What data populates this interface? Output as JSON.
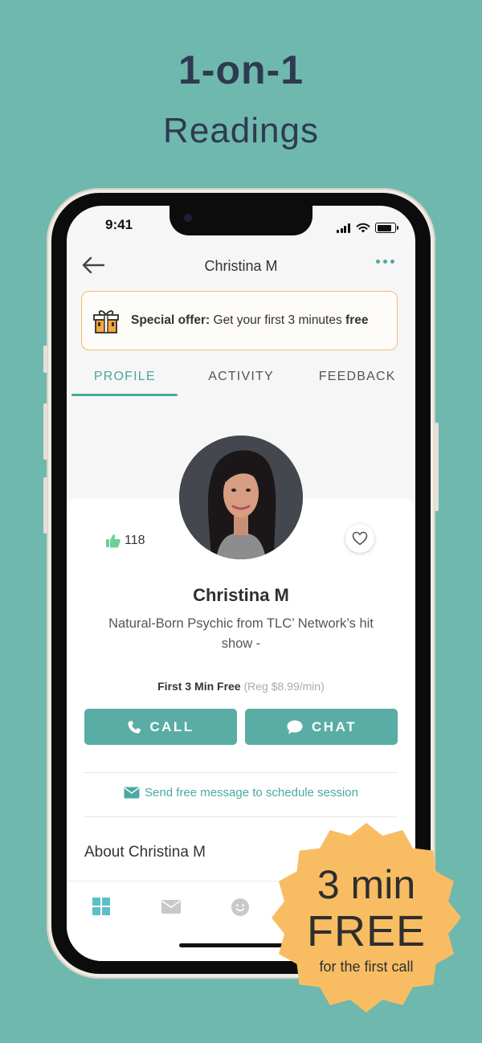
{
  "promo": {
    "line1": "1-on-1",
    "line2": "Readings"
  },
  "status_bar": {
    "time": "9:41"
  },
  "header": {
    "title": "Christina M",
    "back_icon": "arrow-left-icon",
    "more_icon": "more-dots-icon"
  },
  "offer": {
    "label": "Special offer:",
    "text": " Get your first 3 minutes ",
    "bold_tail": "free",
    "icon": "gift-icon"
  },
  "tabs": [
    {
      "label": "PROFILE",
      "active": true
    },
    {
      "label": "ACTIVITY",
      "active": false
    },
    {
      "label": "FEEDBACK",
      "active": false
    }
  ],
  "profile": {
    "likes": "118",
    "name": "Christina M",
    "bio": "Natural-Born Psychic from TLC’ Network’s hit show -",
    "price_bold": "First 3 Min Free",
    "price_reg": "(Reg $8.99/min)",
    "call_label": "CALL",
    "chat_label": "CHAT",
    "send_message": "Send free message to schedule session",
    "about_title": "About Christina M"
  },
  "badge": {
    "line1": "3 min",
    "line2": "FREE",
    "line3": "for the first call"
  },
  "colors": {
    "background": "#6fb8ad",
    "accent": "#4aa9a0",
    "button": "#5aada4",
    "badge": "#f8bd63",
    "offer_border": "#f1bc74"
  }
}
